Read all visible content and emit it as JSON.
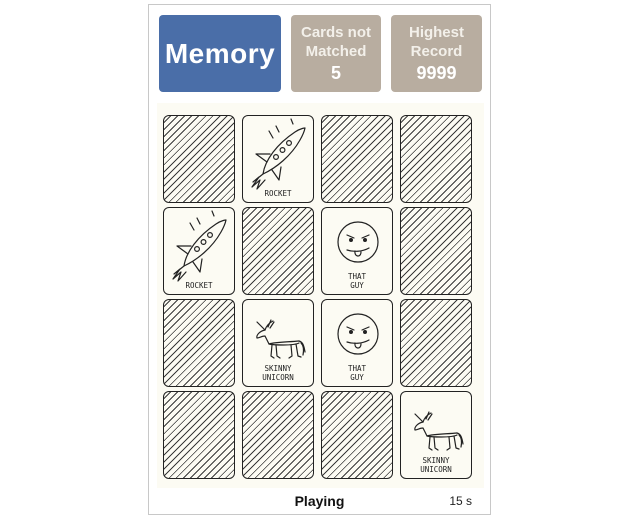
{
  "header": {
    "title": "Memory",
    "not_matched": {
      "label_line1": "Cards not",
      "label_line2": "Matched",
      "value": "5"
    },
    "record": {
      "label_line1": "Highest",
      "label_line2": "Record",
      "value": "9999"
    }
  },
  "board": {
    "rows": [
      [
        {
          "state": "down"
        },
        {
          "state": "up",
          "icon": "rocket-icon",
          "caption": "ROCKET"
        },
        {
          "state": "down"
        },
        {
          "state": "down"
        }
      ],
      [
        {
          "state": "up",
          "icon": "rocket-icon",
          "caption": "ROCKET"
        },
        {
          "state": "down"
        },
        {
          "state": "up",
          "icon": "that-guy-face-icon",
          "caption": "THAT\nGUY"
        },
        {
          "state": "down"
        }
      ],
      [
        {
          "state": "down"
        },
        {
          "state": "up",
          "icon": "skinny-unicorn-icon",
          "caption": "SKINNY\nUNICORN"
        },
        {
          "state": "up",
          "icon": "that-guy-face-icon",
          "caption": "THAT\nGUY"
        },
        {
          "state": "down"
        }
      ],
      [
        {
          "state": "down"
        },
        {
          "state": "down"
        },
        {
          "state": "down"
        },
        {
          "state": "up",
          "icon": "skinny-unicorn-icon",
          "caption": "SKINNY\nUNICORN"
        }
      ]
    ]
  },
  "status": {
    "text": "Playing",
    "timer": "15 s"
  }
}
